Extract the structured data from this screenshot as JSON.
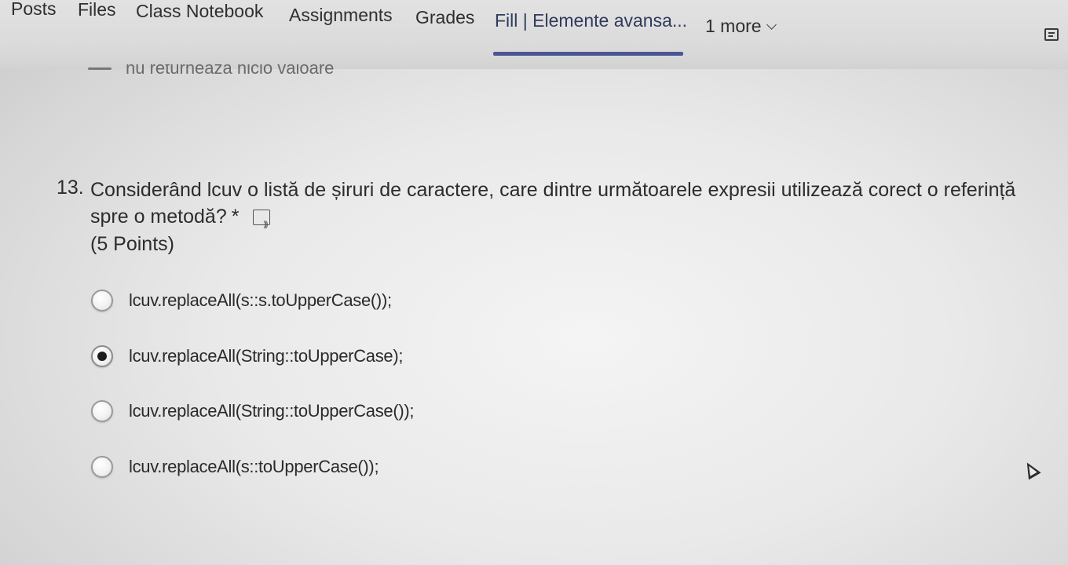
{
  "tabs": [
    {
      "label": "Posts",
      "active": false
    },
    {
      "label": "Files",
      "active": false
    },
    {
      "label": "Class Notebook",
      "active": false
    },
    {
      "label": "Assignments",
      "active": false
    },
    {
      "label": "Grades",
      "active": false
    },
    {
      "label": "Fill | Elemente avansa...",
      "active": true
    },
    {
      "label": "1 more",
      "active": false
    }
  ],
  "previous_item_fragment": "nu returnează nicio valoare",
  "question": {
    "number": "13.",
    "text": "Considerând lcuv o listă de șiruri de caractere, care dintre următoarele expresii utilizează corect o referință spre o metodă?",
    "required_marker": "*",
    "points": "(5 Points)"
  },
  "options": [
    {
      "label": "lcuv.replaceAll(s::s.toUpperCase());",
      "selected": false
    },
    {
      "label": "lcuv.replaceAll(String::toUpperCase);",
      "selected": true
    },
    {
      "label": "lcuv.replaceAll(String::toUpperCase());",
      "selected": false
    },
    {
      "label": "lcuv.replaceAll(s::toUpperCase());",
      "selected": false
    }
  ],
  "colors": {
    "active_tab_underline": "#4b5596",
    "selected_radio_dot": "#1e1e1e"
  },
  "icons": [
    "chevron-down-icon",
    "chat-icon",
    "immersive-reader-icon",
    "cursor-icon"
  ]
}
